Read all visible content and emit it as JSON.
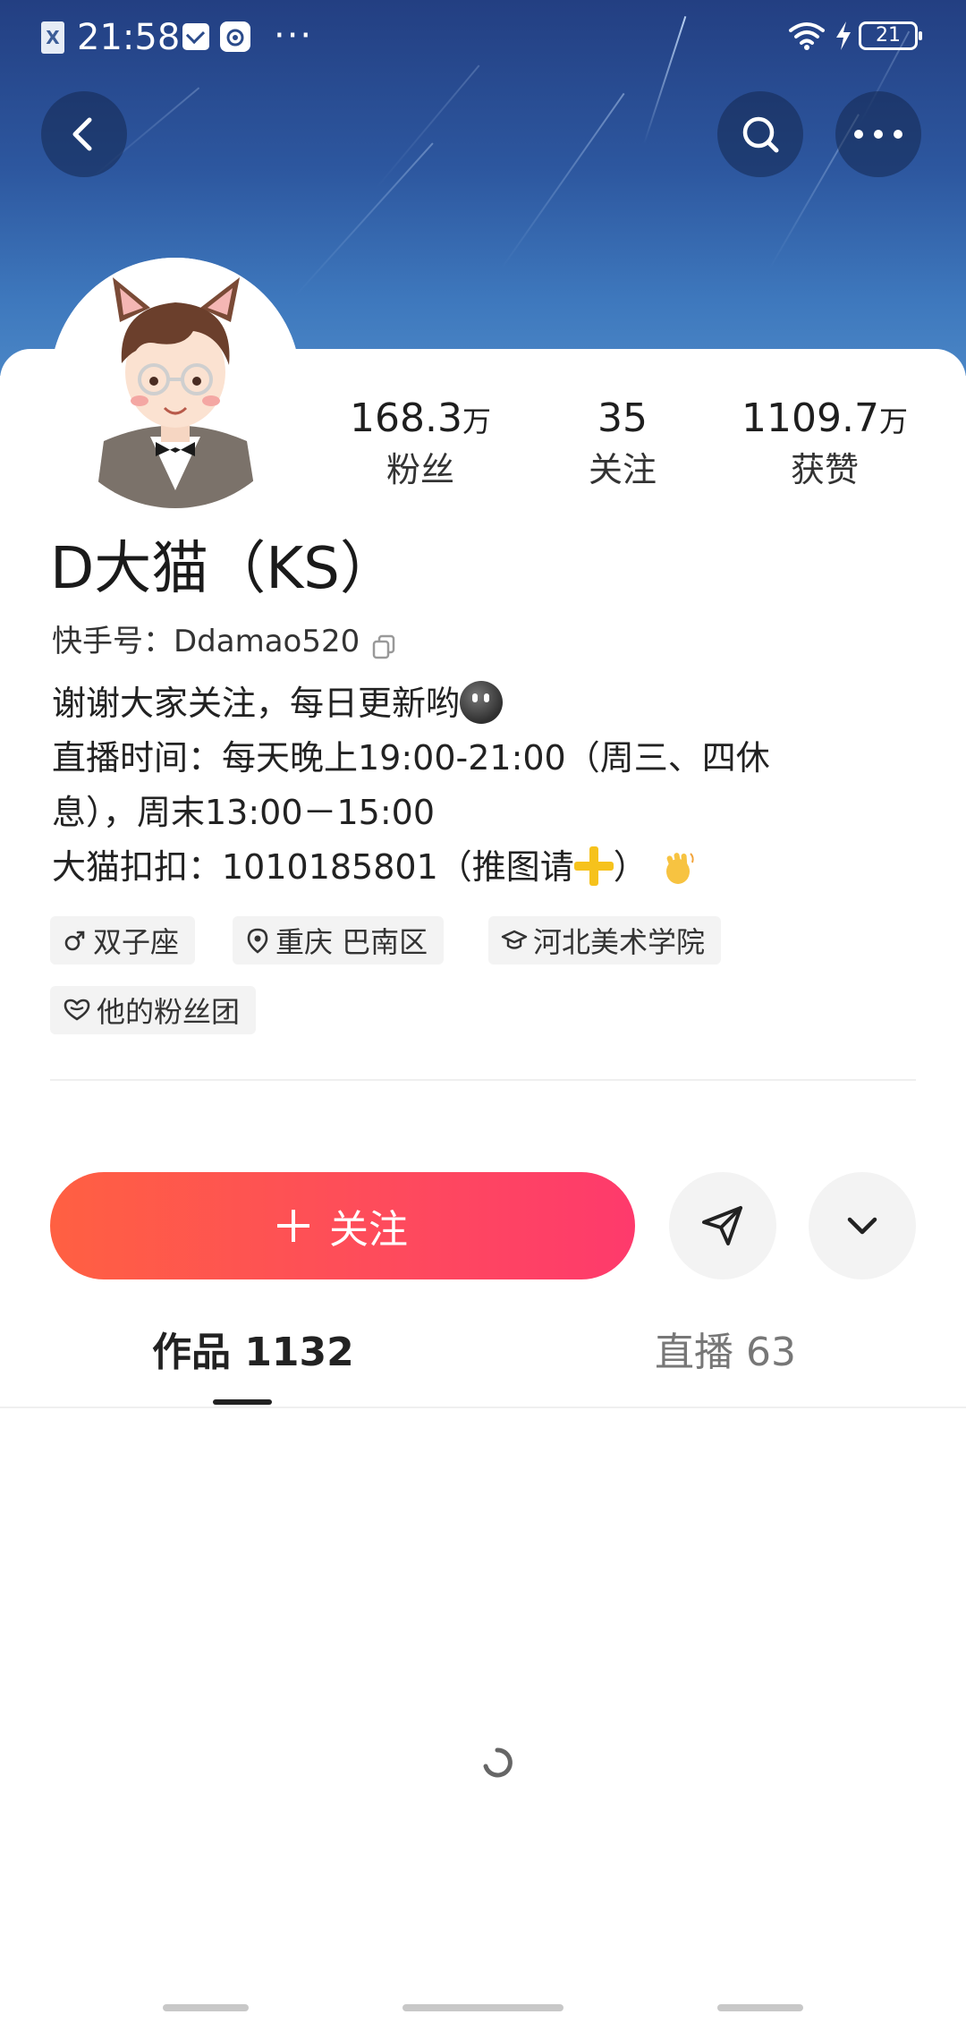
{
  "status_bar": {
    "sim_label": "X",
    "time": "21:58",
    "more": "···",
    "battery": "21"
  },
  "header": {
    "back_icon": "chevron-left-icon",
    "search_icon": "search-icon",
    "more_icon": "more-horizontal-icon"
  },
  "profile": {
    "avatar": "cartoon-cat-ear-boy-avatar",
    "stats": [
      {
        "value": "168.3",
        "unit": "万",
        "label": "粉丝"
      },
      {
        "value": "35",
        "unit": "",
        "label": "关注"
      },
      {
        "value": "1109.7",
        "unit": "万",
        "label": "获赞"
      }
    ],
    "nickname": "D大猫（KS）",
    "id_prefix": "快手号：",
    "id_value": "Ddamao520",
    "bio": {
      "line1": "谢谢大家关注，每日更新哟",
      "line2": "直播时间：每天晚上19:00-21:00（周三、四休",
      "line3": "息），周末13:00－15:00",
      "line4_a": "大猫扣扣：1010185801（推图请",
      "line4_b": "）"
    },
    "tags": {
      "zodiac": "双子座",
      "location": "重庆 巴南区",
      "school": "河北美术学院",
      "fan_group": "他的粉丝团"
    }
  },
  "actions": {
    "follow_label": "关注",
    "share_icon": "send-icon",
    "expand_icon": "chevron-down-icon"
  },
  "tabs": [
    {
      "label": "作品 1132",
      "active": true
    },
    {
      "label": "直播 63",
      "active": false
    }
  ],
  "colors": {
    "follow_start": "#ff6042",
    "follow_end": "#fe3a6c",
    "header_sky": "#2d579f"
  }
}
